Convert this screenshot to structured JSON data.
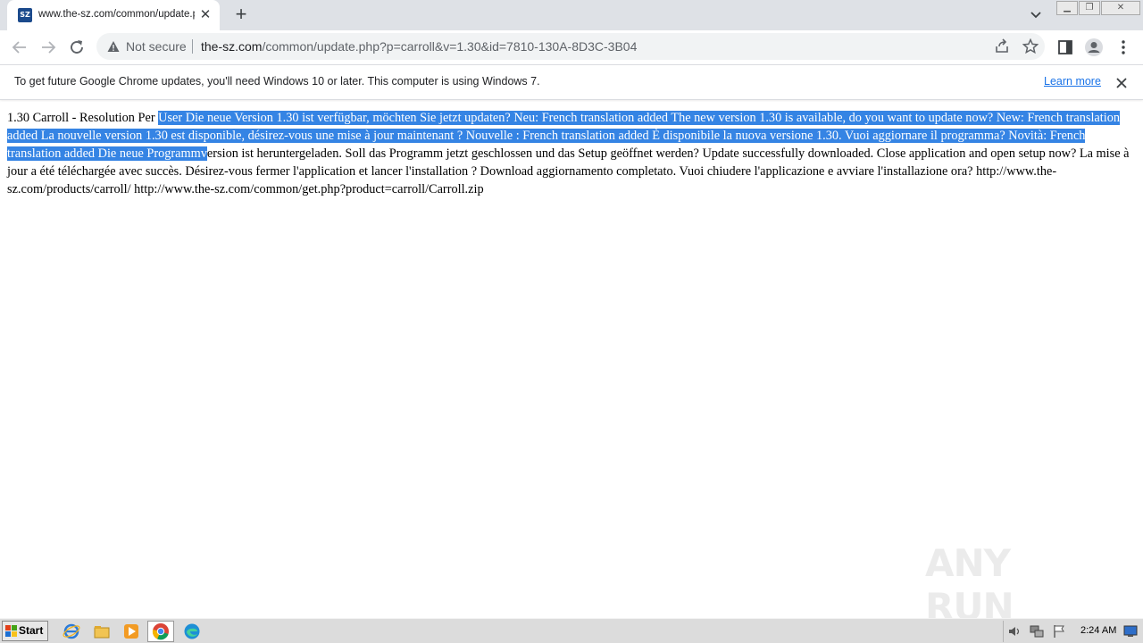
{
  "tab": {
    "title": "www.the-sz.com/common/update.php?p=carroll",
    "favicon_text": "SZ"
  },
  "toolbar": {
    "security_label": "Not secure",
    "url_host": "the-sz.com",
    "url_path": "/common/update.php?p=carroll&v=1.30&id=7810-130A-8D3C-3B04"
  },
  "infobar": {
    "message": "To get future Google Chrome updates, you'll need Windows 10 or later. This computer is using Windows 7.",
    "link": "Learn more"
  },
  "content": {
    "before_selection": "1.30 Carroll - Resolution Per ",
    "selected": "User Die neue Version 1.30 ist verfügbar, möchten Sie jetzt updaten? Neu: French translation added The new version 1.30 is available, do you want to update now? New: French translation added La nouvelle version 1.30 est disponible, désirez-vous une mise à jour maintenant ? Nouvelle : French translation added È disponibile la nuova versione 1.30. Vuoi aggiornare il programma? Novità: French translation added Die neue Programmv",
    "after_selection": "ersion ist heruntergeladen. Soll das Programm jetzt geschlossen und das Setup geöffnet werden? Update successfully downloaded. Close application and open setup now? La mise à jour a été téléchargée avec succès. Désirez-vous fermer l'application et lancer l'installation ? Download aggiornamento completato. Vuoi chiudere l'applicazione e avviare l'installazione ora? http://www.the-sz.com/products/carroll/ http://www.the-sz.com/common/get.php?product=carroll/Carroll.zip"
  },
  "watermark": {
    "text": "ANY RUN"
  },
  "taskbar": {
    "start_label": "Start",
    "clock": "2:24 AM"
  },
  "colors": {
    "selection": "#3584e4",
    "link": "#1a73e8",
    "tabstrip": "#dee1e6"
  }
}
